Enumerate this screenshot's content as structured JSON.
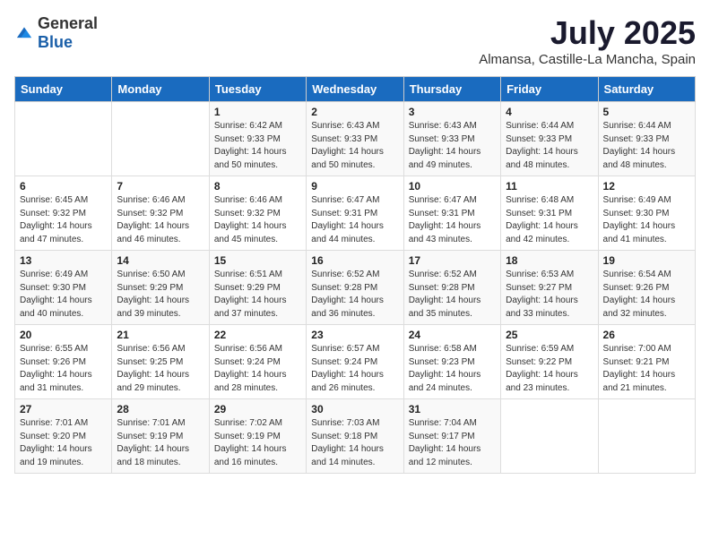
{
  "logo": {
    "general": "General",
    "blue": "Blue"
  },
  "title": "July 2025",
  "location": "Almansa, Castille-La Mancha, Spain",
  "headers": [
    "Sunday",
    "Monday",
    "Tuesday",
    "Wednesday",
    "Thursday",
    "Friday",
    "Saturday"
  ],
  "weeks": [
    [
      {
        "day": "",
        "info": ""
      },
      {
        "day": "",
        "info": ""
      },
      {
        "day": "1",
        "info": "Sunrise: 6:42 AM\nSunset: 9:33 PM\nDaylight: 14 hours and 50 minutes."
      },
      {
        "day": "2",
        "info": "Sunrise: 6:43 AM\nSunset: 9:33 PM\nDaylight: 14 hours and 50 minutes."
      },
      {
        "day": "3",
        "info": "Sunrise: 6:43 AM\nSunset: 9:33 PM\nDaylight: 14 hours and 49 minutes."
      },
      {
        "day": "4",
        "info": "Sunrise: 6:44 AM\nSunset: 9:33 PM\nDaylight: 14 hours and 48 minutes."
      },
      {
        "day": "5",
        "info": "Sunrise: 6:44 AM\nSunset: 9:33 PM\nDaylight: 14 hours and 48 minutes."
      }
    ],
    [
      {
        "day": "6",
        "info": "Sunrise: 6:45 AM\nSunset: 9:32 PM\nDaylight: 14 hours and 47 minutes."
      },
      {
        "day": "7",
        "info": "Sunrise: 6:46 AM\nSunset: 9:32 PM\nDaylight: 14 hours and 46 minutes."
      },
      {
        "day": "8",
        "info": "Sunrise: 6:46 AM\nSunset: 9:32 PM\nDaylight: 14 hours and 45 minutes."
      },
      {
        "day": "9",
        "info": "Sunrise: 6:47 AM\nSunset: 9:31 PM\nDaylight: 14 hours and 44 minutes."
      },
      {
        "day": "10",
        "info": "Sunrise: 6:47 AM\nSunset: 9:31 PM\nDaylight: 14 hours and 43 minutes."
      },
      {
        "day": "11",
        "info": "Sunrise: 6:48 AM\nSunset: 9:31 PM\nDaylight: 14 hours and 42 minutes."
      },
      {
        "day": "12",
        "info": "Sunrise: 6:49 AM\nSunset: 9:30 PM\nDaylight: 14 hours and 41 minutes."
      }
    ],
    [
      {
        "day": "13",
        "info": "Sunrise: 6:49 AM\nSunset: 9:30 PM\nDaylight: 14 hours and 40 minutes."
      },
      {
        "day": "14",
        "info": "Sunrise: 6:50 AM\nSunset: 9:29 PM\nDaylight: 14 hours and 39 minutes."
      },
      {
        "day": "15",
        "info": "Sunrise: 6:51 AM\nSunset: 9:29 PM\nDaylight: 14 hours and 37 minutes."
      },
      {
        "day": "16",
        "info": "Sunrise: 6:52 AM\nSunset: 9:28 PM\nDaylight: 14 hours and 36 minutes."
      },
      {
        "day": "17",
        "info": "Sunrise: 6:52 AM\nSunset: 9:28 PM\nDaylight: 14 hours and 35 minutes."
      },
      {
        "day": "18",
        "info": "Sunrise: 6:53 AM\nSunset: 9:27 PM\nDaylight: 14 hours and 33 minutes."
      },
      {
        "day": "19",
        "info": "Sunrise: 6:54 AM\nSunset: 9:26 PM\nDaylight: 14 hours and 32 minutes."
      }
    ],
    [
      {
        "day": "20",
        "info": "Sunrise: 6:55 AM\nSunset: 9:26 PM\nDaylight: 14 hours and 31 minutes."
      },
      {
        "day": "21",
        "info": "Sunrise: 6:56 AM\nSunset: 9:25 PM\nDaylight: 14 hours and 29 minutes."
      },
      {
        "day": "22",
        "info": "Sunrise: 6:56 AM\nSunset: 9:24 PM\nDaylight: 14 hours and 28 minutes."
      },
      {
        "day": "23",
        "info": "Sunrise: 6:57 AM\nSunset: 9:24 PM\nDaylight: 14 hours and 26 minutes."
      },
      {
        "day": "24",
        "info": "Sunrise: 6:58 AM\nSunset: 9:23 PM\nDaylight: 14 hours and 24 minutes."
      },
      {
        "day": "25",
        "info": "Sunrise: 6:59 AM\nSunset: 9:22 PM\nDaylight: 14 hours and 23 minutes."
      },
      {
        "day": "26",
        "info": "Sunrise: 7:00 AM\nSunset: 9:21 PM\nDaylight: 14 hours and 21 minutes."
      }
    ],
    [
      {
        "day": "27",
        "info": "Sunrise: 7:01 AM\nSunset: 9:20 PM\nDaylight: 14 hours and 19 minutes."
      },
      {
        "day": "28",
        "info": "Sunrise: 7:01 AM\nSunset: 9:19 PM\nDaylight: 14 hours and 18 minutes."
      },
      {
        "day": "29",
        "info": "Sunrise: 7:02 AM\nSunset: 9:19 PM\nDaylight: 14 hours and 16 minutes."
      },
      {
        "day": "30",
        "info": "Sunrise: 7:03 AM\nSunset: 9:18 PM\nDaylight: 14 hours and 14 minutes."
      },
      {
        "day": "31",
        "info": "Sunrise: 7:04 AM\nSunset: 9:17 PM\nDaylight: 14 hours and 12 minutes."
      },
      {
        "day": "",
        "info": ""
      },
      {
        "day": "",
        "info": ""
      }
    ]
  ]
}
